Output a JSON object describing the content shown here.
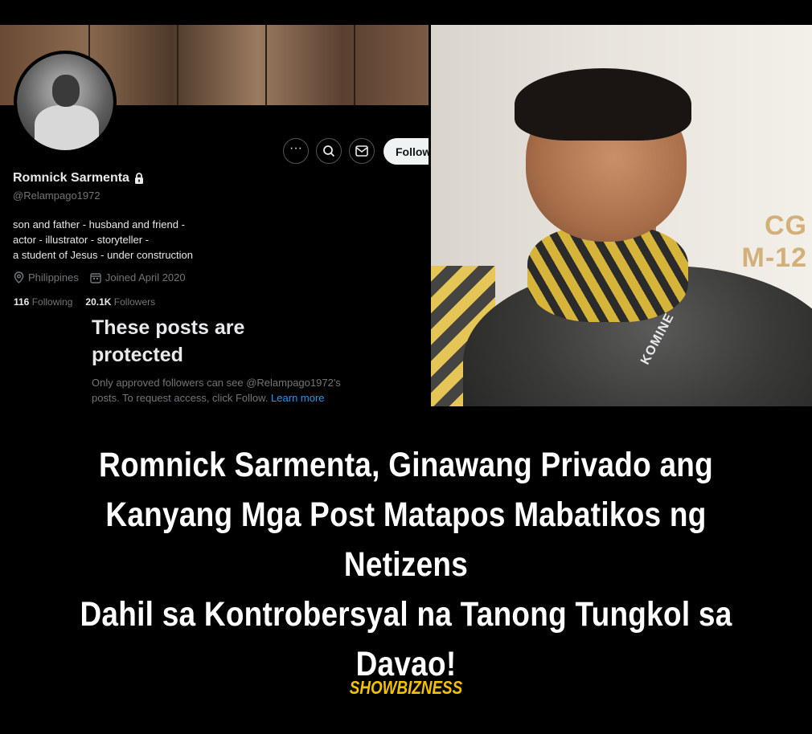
{
  "profile": {
    "name": "Romnick Sarmenta",
    "lock_icon": "lock-icon",
    "handle": "@Relampago1972",
    "bio_lines": [
      "son and father - husband and friend -",
      "actor - illustrator - storyteller -",
      "a student of Jesus - under construction"
    ],
    "location": "Philippines",
    "joined": "Joined April 2020",
    "following_count": "116",
    "following_label": "Following",
    "followers_count": "20.1K",
    "followers_label": "Followers",
    "follow_button": "Follow",
    "more_icon": "more-icon",
    "search_icon": "search-icon",
    "message_icon": "message-icon"
  },
  "protected": {
    "title_line1": "These posts are",
    "title_line2": "protected",
    "desc_line1": "Only approved followers can see @Relampago1972's",
    "desc_line2": "posts. To request access, click Follow.",
    "learn_more": "Learn more"
  },
  "photo": {
    "wall_text_1": "CG",
    "wall_text_2": "M-12",
    "jacket_brand": "KOMINE"
  },
  "headline": {
    "line1": "Romnick Sarmenta, Ginawang Privado ang",
    "line2": "Kanyang Mga Post Matapos Mabatikos ng Netizens",
    "line3": "Dahil sa Kontrobersyal na Tanong Tungkol sa",
    "line4": "Davao!"
  },
  "credit": "SHOWBIZNESS",
  "colors": {
    "background": "#000000",
    "accent": "#f2c200",
    "link": "#1d9bf0",
    "muted": "#71767b"
  }
}
